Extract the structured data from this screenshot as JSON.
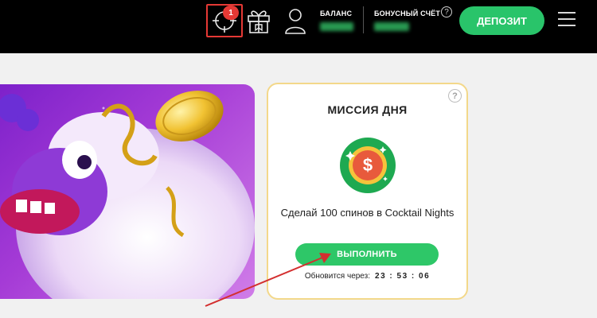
{
  "header": {
    "mission_badge": "1",
    "mission_icon": "crosshair-icon",
    "gift_icon": "gift-icon",
    "user_icon": "user-icon",
    "balance_label": "БАЛАНС",
    "bonus_label": "БОНУСНЫЙ СЧЁТ",
    "bonus_help": "?",
    "deposit_label": "ДЕПОЗИТ",
    "menu_icon": "hamburger-icon",
    "colors": {
      "background": "#000000",
      "accent": "#29c46a",
      "badge": "#e53935"
    }
  },
  "mission": {
    "help": "?",
    "title": "МИССИЯ ДНЯ",
    "icon": "dollar-coin-icon",
    "description": "Сделай 100 спинов в Cocktail Nights",
    "button_label": "ВЫПОЛНИТЬ",
    "refresh_label": "Обновится через:",
    "refresh_time": "23 : 53 : 06",
    "colors": {
      "border": "#f3d88a",
      "button": "#2ec768"
    }
  },
  "annotation": {
    "color": "#d32f2f"
  }
}
